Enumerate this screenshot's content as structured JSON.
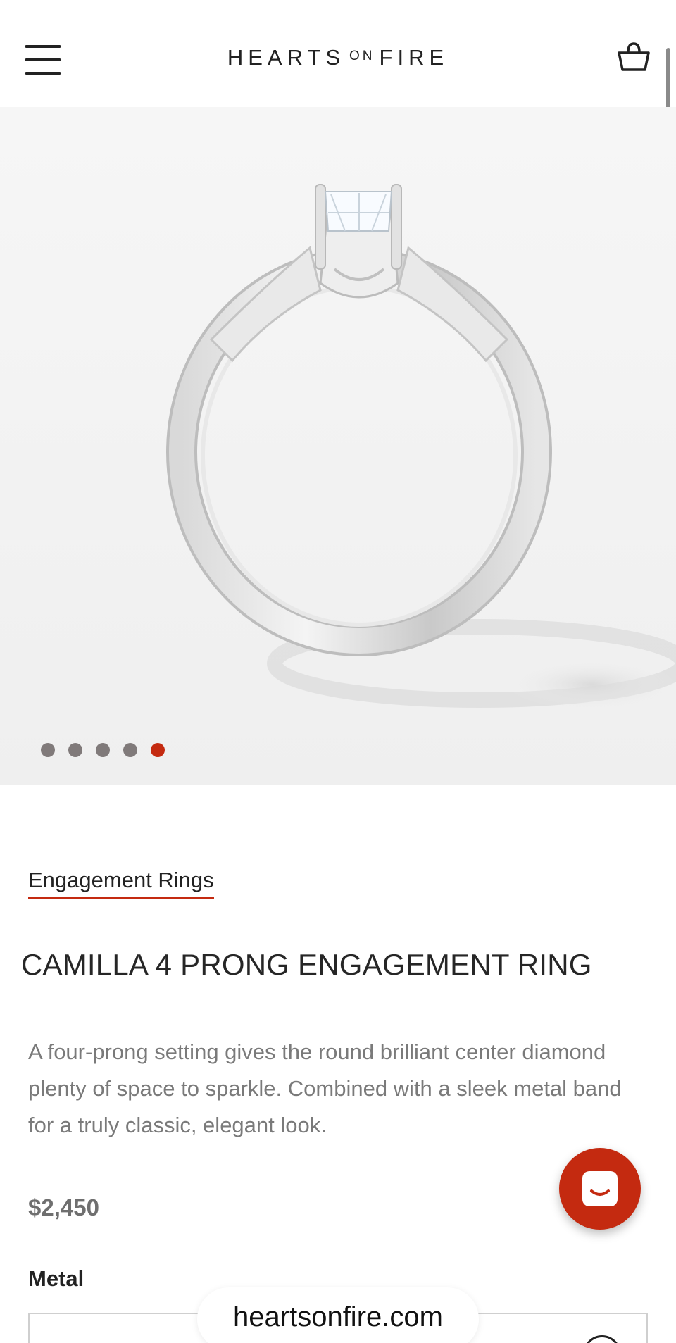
{
  "header": {
    "logo_left": "HEARTS",
    "logo_on": "ON",
    "logo_right": "FIRE",
    "menu_icon": "hamburger-menu-icon",
    "cart_icon": "shopping-bag-icon"
  },
  "gallery": {
    "slide_count": 5,
    "active_slide": 5,
    "dot_color": "#807a7a",
    "active_dot_color": "#c42a10"
  },
  "product": {
    "breadcrumb": "Engagement Rings",
    "title": "CAMILLA 4 PRONG ENGAGEMENT RING",
    "description": "A four-prong setting gives the round brilliant center diamond plenty of space to sparkle. Combined with a sleek metal band for a truly classic, elegant look.",
    "price": "$2,450",
    "metal_label": "Metal"
  },
  "chat": {
    "icon": "chat-bubble-icon",
    "color": "#c42a10"
  },
  "browser": {
    "url": "heartsonfire.com"
  },
  "colors": {
    "accent": "#c42a10",
    "text": "#222222",
    "muted": "#7a7a7a"
  }
}
